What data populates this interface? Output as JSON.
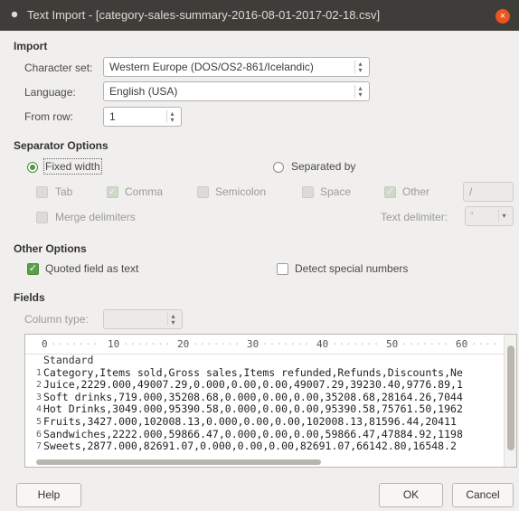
{
  "window": {
    "title": "Text Import - [category-sales-summary-2016-08-01-2017-02-18.csv]",
    "close_glyph": "×"
  },
  "import": {
    "section_label": "Import",
    "charset_label": "Character set:",
    "charset_value": "Western Europe (DOS/OS2-861/Icelandic)",
    "language_label": "Language:",
    "language_value": "English (USA)",
    "from_row_label": "From row:",
    "from_row_value": "1"
  },
  "separator": {
    "section_label": "Separator Options",
    "fixed_width_label": "Fixed width",
    "fixed_width_selected": true,
    "separated_by_label": "Separated by",
    "tab_label": "Tab",
    "comma_label": "Comma",
    "semicolon_label": "Semicolon",
    "space_label": "Space",
    "other_label": "Other",
    "other_value": "/",
    "merge_label": "Merge delimiters",
    "text_delimiter_label": "Text delimiter:",
    "text_delimiter_value": "'"
  },
  "other_options": {
    "section_label": "Other Options",
    "quoted_label": "Quoted field as text",
    "detect_label": "Detect special numbers"
  },
  "fields": {
    "section_label": "Fields",
    "column_type_label": "Column type:",
    "column_type_value": "",
    "ruler": [
      "0",
      "10",
      "20",
      "30",
      "40",
      "50",
      "60"
    ],
    "header_row": "Standard",
    "rows": [
      {
        "num": "1",
        "text": "Category,Items sold,Gross sales,Items refunded,Refunds,Discounts,Ne"
      },
      {
        "num": "2",
        "text": "Juice,2229.000,49007.29,0.000,0.00,0.00,49007.29,39230.40,9776.89,1"
      },
      {
        "num": "3",
        "text": "Soft drinks,719.000,35208.68,0.000,0.00,0.00,35208.68,28164.26,7044"
      },
      {
        "num": "4",
        "text": "Hot Drinks,3049.000,95390.58,0.000,0.00,0.00,95390.58,75761.50,1962"
      },
      {
        "num": "5",
        "text": "Fruits,3427.000,102008.13,0.000,0.00,0.00,102008.13,81596.44,20411"
      },
      {
        "num": "6",
        "text": "Sandwiches,2222.000,59866.47,0.000,0.00,0.00,59866.47,47884.92,1198"
      },
      {
        "num": "7",
        "text": "Sweets,2877.000,82691.07,0.000,0.00,0.00,82691.07,66142.80,16548.2"
      }
    ]
  },
  "buttons": {
    "help": "Help",
    "ok": "OK",
    "cancel": "Cancel"
  }
}
